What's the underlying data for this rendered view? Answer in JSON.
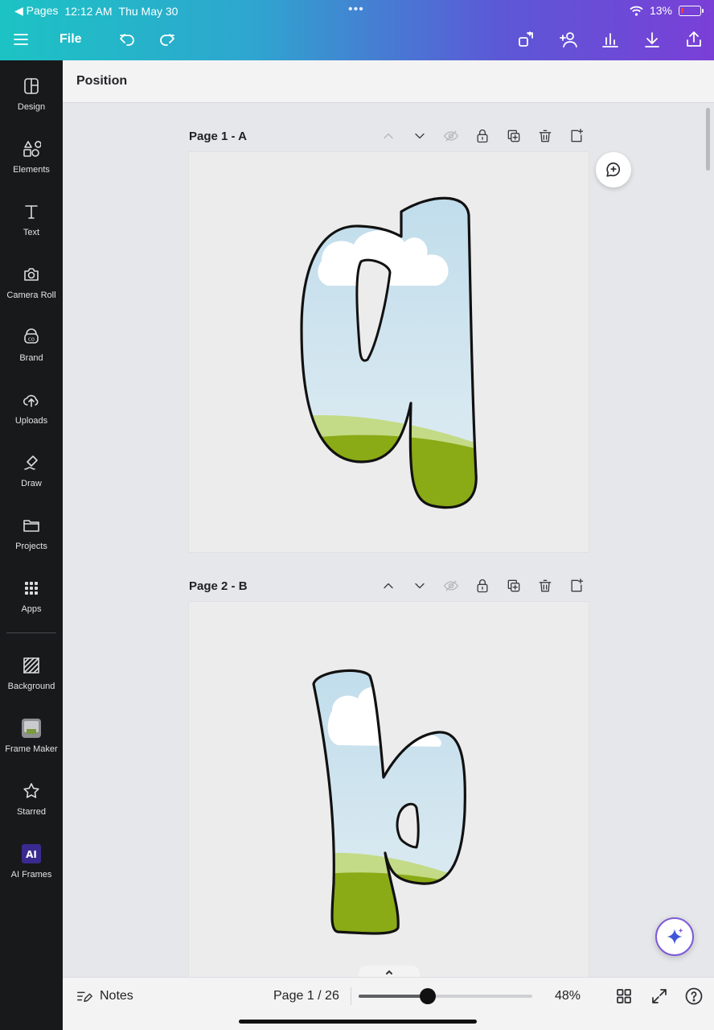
{
  "status_bar": {
    "back_app": "◀ Pages",
    "time": "12:12 AM",
    "date": "Thu May 30",
    "dots": "•••",
    "battery": "13%"
  },
  "toolbar": {
    "file_label": "File"
  },
  "sidebar": {
    "items": [
      {
        "label": "Design",
        "icon": "design-icon"
      },
      {
        "label": "Elements",
        "icon": "elements-icon"
      },
      {
        "label": "Text",
        "icon": "text-icon"
      },
      {
        "label": "Camera Roll",
        "icon": "camera-icon"
      },
      {
        "label": "Brand",
        "icon": "brand-icon"
      },
      {
        "label": "Uploads",
        "icon": "upload-cloud-icon"
      },
      {
        "label": "Draw",
        "icon": "draw-icon"
      },
      {
        "label": "Projects",
        "icon": "folder-icon"
      },
      {
        "label": "Apps",
        "icon": "apps-grid-icon"
      },
      {
        "label": "Background",
        "icon": "background-icon"
      },
      {
        "label": "Frame Maker",
        "icon": "frame-maker-icon"
      },
      {
        "label": "Starred",
        "icon": "star-icon"
      },
      {
        "label": "AI Frames",
        "icon": "ai-frames-icon"
      }
    ]
  },
  "position_panel": {
    "title": "Position"
  },
  "pages": [
    {
      "title": "Page 1 - A"
    },
    {
      "title": "Page 2 - B"
    }
  ],
  "bottom_bar": {
    "notes_label": "Notes",
    "page_indicator": "Page 1 / 26",
    "zoom_label": "48%",
    "zoom_fraction": 0.4
  },
  "colors": {
    "accent_gradient_start": "#1cc3c4",
    "accent_gradient_end": "#7a3fd7",
    "sidebar_bg": "#18191b",
    "sky": "#c9e3ef",
    "grass": "#8aaa16"
  }
}
